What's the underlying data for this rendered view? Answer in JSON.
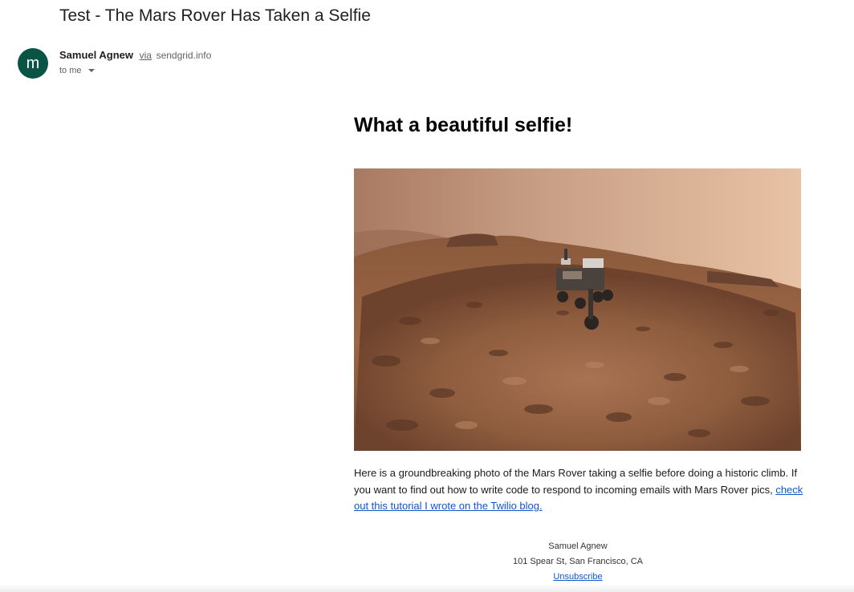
{
  "email": {
    "subject": "Test - The Mars Rover Has Taken a Selfie",
    "sender": {
      "avatar_letter": "m",
      "name": "Samuel Agnew",
      "via": "via",
      "domain": "sendgrid.info"
    },
    "recipient": "to me"
  },
  "content": {
    "heading": "What a beautiful selfie!",
    "image": "mars-rover-selfie",
    "paragraph": "Here is a groundbreaking photo of the Mars Rover taking a selfie before doing a historic climb. If you want to find out how to write code to respond to incoming emails with Mars Rover pics, ",
    "link_text": "check out this tutorial I wrote on the Twilio blog."
  },
  "footer": {
    "name": "Samuel Agnew",
    "address": "101 Spear St, San Francisco, CA",
    "unsubscribe": "Unsubscribe"
  },
  "colors": {
    "avatar_bg": "#0b5345",
    "link": "#1155cc"
  }
}
